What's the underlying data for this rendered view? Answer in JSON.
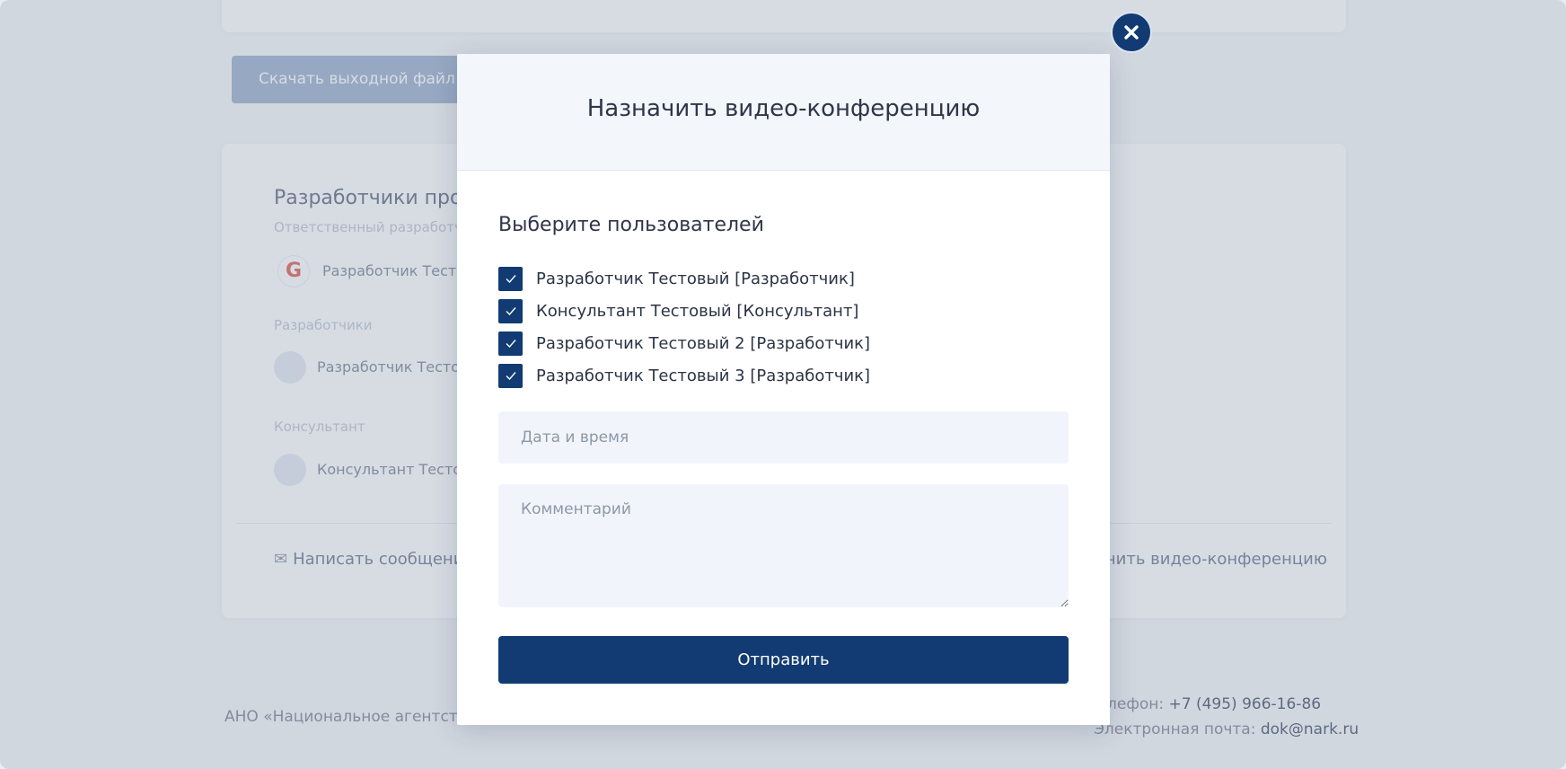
{
  "background": {
    "download_button": "Скачать выходной файл",
    "card": {
      "heading": "Разработчики прое",
      "subheading": "Ответственный разработчик",
      "responsible_name": "Разработчик Тестов",
      "developers_label": "Разработчики",
      "developer_name": "Разработчик Тестовь",
      "consultant_label": "Консультант",
      "consultant_name": "Консультант Тестовь",
      "action_message": "Написать сообщение",
      "action_video": "ачить видео-конференцию"
    },
    "footer": {
      "org": "АНО «Национальное агентств",
      "phone_label": "лефон: ",
      "phone": "+7 (495) 966-16-86",
      "email_label": "Электронная почта: ",
      "email": "dok@nark.ru"
    }
  },
  "modal": {
    "title": "Назначить видео-конференцию",
    "select_users_title": "Выберите пользователей",
    "users": [
      {
        "label": "Разработчик Тестовый [Разработчик]",
        "checked": true
      },
      {
        "label": "Консультант Тестовый [Консультант]",
        "checked": true
      },
      {
        "label": "Разработчик Тестовый 2 [Разработчик]",
        "checked": true
      },
      {
        "label": "Разработчик Тестовый 3 [Разработчик]",
        "checked": true
      }
    ],
    "datetime_placeholder": "Дата и время",
    "comment_placeholder": "Комментарий",
    "submit_label": "Отправить",
    "close_icon": "close-icon"
  },
  "colors": {
    "primary": "#113b72",
    "header_bg": "#f3f6fb",
    "input_bg": "#f1f5fb"
  }
}
